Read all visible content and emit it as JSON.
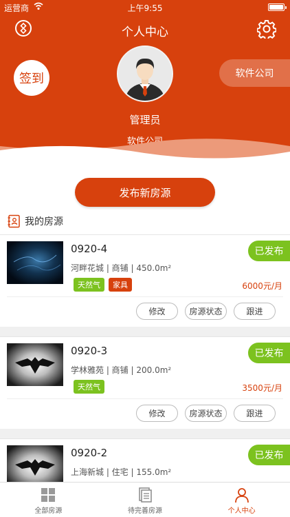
{
  "status_bar": {
    "carrier": "运营商",
    "time": "上午9:55"
  },
  "header": {
    "title": "个人中心",
    "checkin_label": "签到",
    "company_tag": "软件公司",
    "user_name": "管理员",
    "user_company": "软件公司"
  },
  "publish_button": "发布新房源",
  "section_title": "我的房源",
  "listings": [
    {
      "title": "0920-4",
      "subtitle": "河畔花城 | 商铺 | 450.0m²",
      "tags": [
        "天然气",
        "家具"
      ],
      "status": "已发布",
      "price": "6000元/月",
      "actions": [
        "修改",
        "房源状态",
        "跟进"
      ]
    },
    {
      "title": "0920-3",
      "subtitle": "学林雅苑 | 商铺 | 200.0m²",
      "tags": [
        "天然气"
      ],
      "status": "已发布",
      "price": "3500元/月",
      "actions": [
        "修改",
        "房源状态",
        "跟进"
      ]
    },
    {
      "title": "0920-2",
      "subtitle": "上海新城 | 住宅 | 155.0m²",
      "tags": [],
      "status": "已发布",
      "price": "",
      "actions": []
    }
  ],
  "tab_bar": {
    "tabs": [
      {
        "label": "全部房源",
        "icon": "grid-icon"
      },
      {
        "label": "待完善房源",
        "icon": "document-icon"
      },
      {
        "label": "个人中心",
        "icon": "person-icon"
      }
    ],
    "active_index": 2
  },
  "colors": {
    "brand": "#d7410d",
    "published": "#7cc21f"
  }
}
